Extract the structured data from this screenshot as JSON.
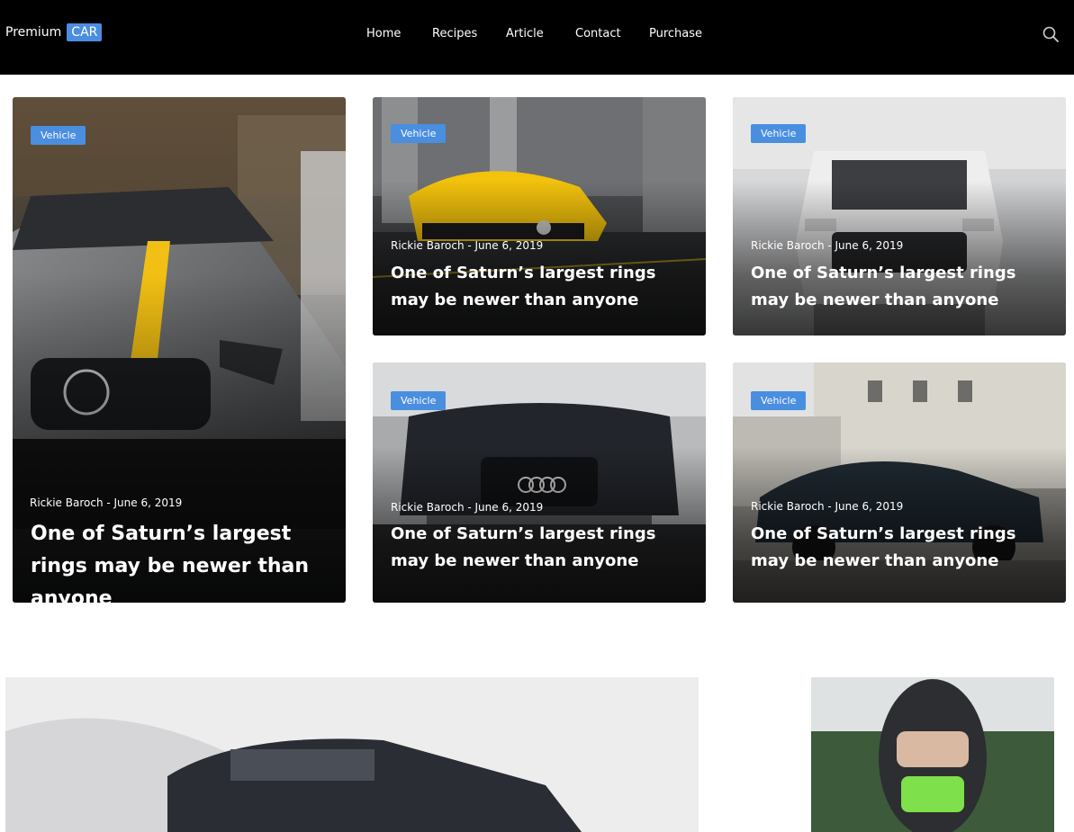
{
  "header": {
    "logo_text": "Premium",
    "logo_badge": "CAR",
    "nav": [
      "Home",
      "Recipes",
      "Article",
      "Contact",
      "Purchase"
    ],
    "search_icon": "search-icon"
  },
  "colors": {
    "header_bg": "#000000",
    "accent": "#4a8ee0",
    "text_on_dark": "#ffffff"
  },
  "cards": [
    {
      "tag": "Vehicle",
      "meta": "Rickie Baroch - June 6, 2019",
      "title": "One of Saturn’s largest rings may be newer than anyone"
    },
    {
      "tag": "Vehicle",
      "meta": "Rickie Baroch - June 6, 2019",
      "title": "One of Saturn’s largest rings may be newer than anyone"
    },
    {
      "tag": "Vehicle",
      "meta": "Rickie Baroch - June 6, 2019",
      "title": "One of Saturn’s largest rings may be newer than anyone"
    },
    {
      "tag": "Vehicle",
      "meta": "Rickie Baroch - June 6, 2019",
      "title": "One of Saturn’s largest rings may be newer than anyone"
    },
    {
      "tag": "Vehicle",
      "meta": "Rickie Baroch - June 6, 2019",
      "title": "One of Saturn’s largest rings may be newer than anyone"
    }
  ]
}
